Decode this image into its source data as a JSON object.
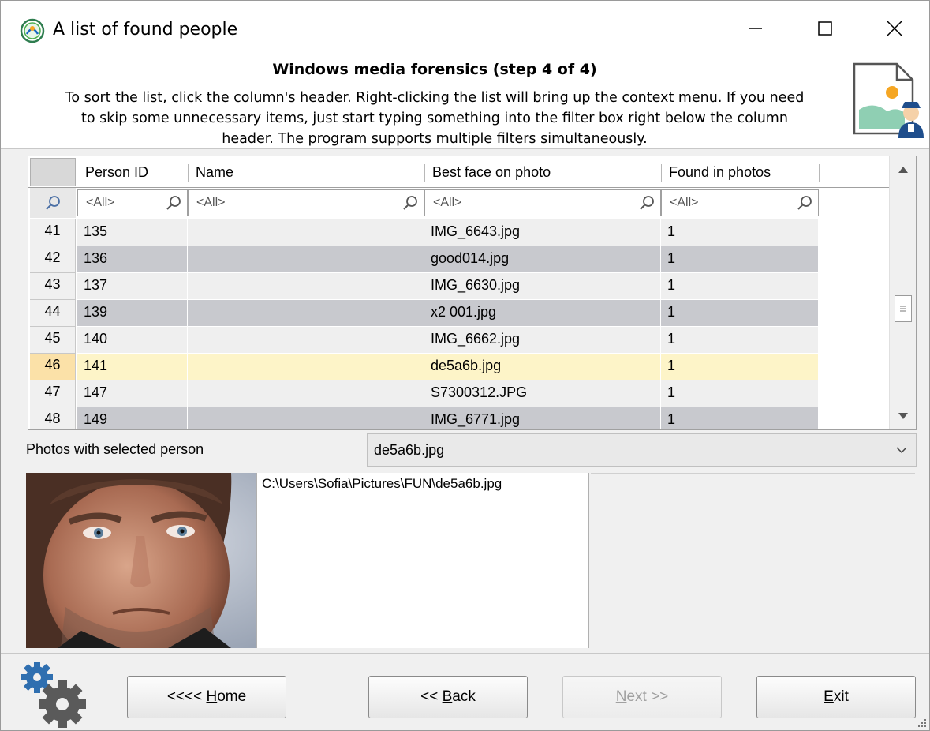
{
  "window": {
    "title": "A list of found people",
    "minimize": "—",
    "maximize": "☐",
    "close": "✕"
  },
  "header": {
    "title": "Windows media forensics (step 4 of 4)",
    "description_line1": "To sort the list, click the column's header. Right-clicking the list will bring up the context menu. If you need",
    "description_line2": "to skip some unnecessary items, just start typing something into the filter box right below the column",
    "description_line3": "header. The program supports multiple filters simultaneously."
  },
  "grid": {
    "columns": [
      "Person ID",
      "Name",
      "Best face on photo",
      "Found in photos"
    ],
    "filters": [
      "<All>",
      "<All>",
      "<All>",
      "<All>"
    ],
    "rows": [
      {
        "num": "41",
        "id": "135",
        "name": "",
        "photo": "IMG_6643.jpg",
        "count": "1"
      },
      {
        "num": "42",
        "id": "136",
        "name": "",
        "photo": "good014.jpg",
        "count": "1"
      },
      {
        "num": "43",
        "id": "137",
        "name": "",
        "photo": "IMG_6630.jpg",
        "count": "1"
      },
      {
        "num": "44",
        "id": "139",
        "name": "",
        "photo": "x2 001.jpg",
        "count": "1"
      },
      {
        "num": "45",
        "id": "140",
        "name": "",
        "photo": "IMG_6662.jpg",
        "count": "1"
      },
      {
        "num": "46",
        "id": "141",
        "name": "",
        "photo": "de5a6b.jpg",
        "count": "1"
      },
      {
        "num": "47",
        "id": "147",
        "name": "",
        "photo": "S7300312.JPG",
        "count": "1"
      },
      {
        "num": "48",
        "id": "149",
        "name": "",
        "photo": "IMG_6771.jpg",
        "count": "1"
      }
    ],
    "selected_row": "46"
  },
  "photos": {
    "label": "Photos with selected person",
    "selected": "de5a6b.jpg",
    "path": "C:\\Users\\Sofia\\Pictures\\FUN\\de5a6b.jpg"
  },
  "footer": {
    "home": {
      "prefix": "<<<< ",
      "accel": "H",
      "rest": "ome"
    },
    "back": {
      "prefix": "<< ",
      "accel": "B",
      "rest": "ack"
    },
    "next": {
      "prefix": "",
      "accel": "N",
      "rest": "ext >>"
    },
    "exit": {
      "prefix": "",
      "accel": "E",
      "rest": "xit"
    }
  }
}
